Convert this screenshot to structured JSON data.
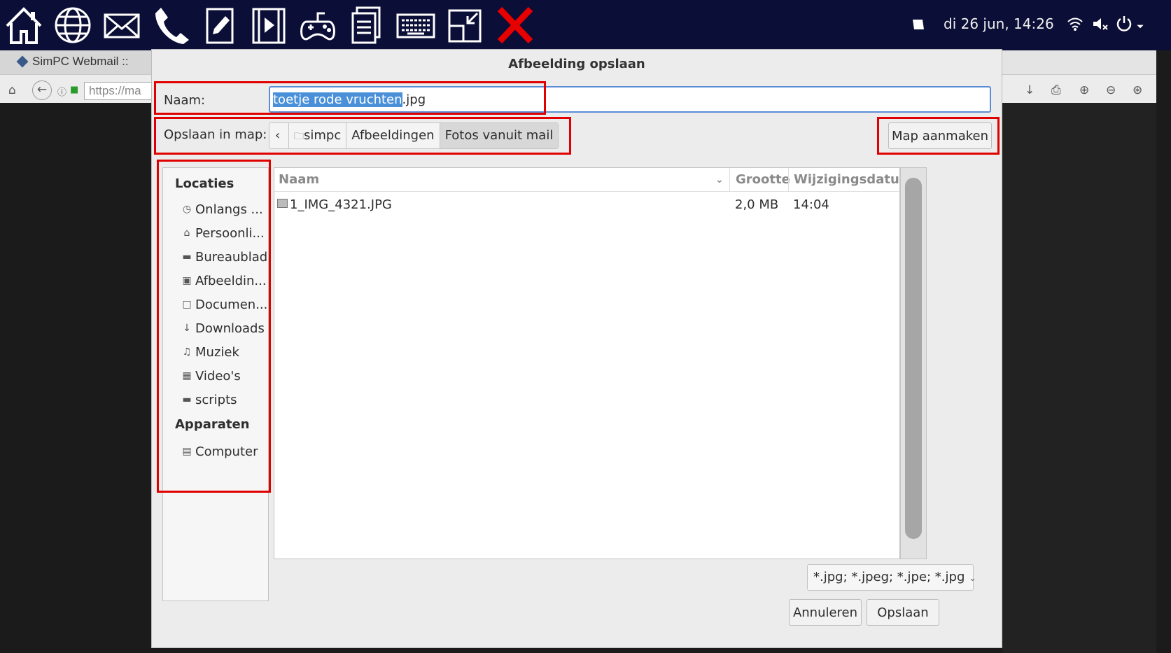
{
  "panel": {
    "clock": "di 26 jun, 14:26",
    "icons": [
      "home-icon",
      "globe-icon",
      "mail-icon",
      "phone-icon",
      "edit-icon",
      "video-icon",
      "gamepad-icon",
      "document-icon",
      "keyboard-icon",
      "resize-icon",
      "close-icon"
    ],
    "close_color": "#e60000"
  },
  "browser": {
    "tab_title": "SimPC Webmail ::",
    "url": "https://ma"
  },
  "dialog": {
    "title": "Afbeelding opslaan",
    "name_label": "Naam:",
    "name_selected": "toetje rode vruchten",
    "name_rest": ".jpg",
    "folder_label": "Opslaan in map:",
    "breadcrumbs": [
      "simpc",
      "Afbeeldingen",
      "Fotos vanuit mail"
    ],
    "new_folder_button": "Map aanmaken",
    "places_header": "Locaties",
    "places": [
      "Onlangs ...",
      "Persoonli...",
      "Bureaublad",
      "Afbeeldin...",
      "Documen...",
      "Downloads",
      "Muziek",
      "Video's",
      "scripts"
    ],
    "devices_header": "Apparaten",
    "devices": [
      "Computer"
    ],
    "columns": {
      "name": "Naam",
      "size": "Grootte",
      "modified": "Wijzigingsdatum"
    },
    "files": [
      {
        "name": "1_IMG_4321.JPG",
        "size": "2,0 MB",
        "modified": "14:04"
      }
    ],
    "filter": "*.jpg; *.jpeg; *.jpe; *.jpg",
    "cancel_button": "Annuleren",
    "save_button": "Opslaan"
  },
  "colors": {
    "highlight": "#e10000",
    "selection": "#4a90d9",
    "panel": "#0b0e36"
  }
}
